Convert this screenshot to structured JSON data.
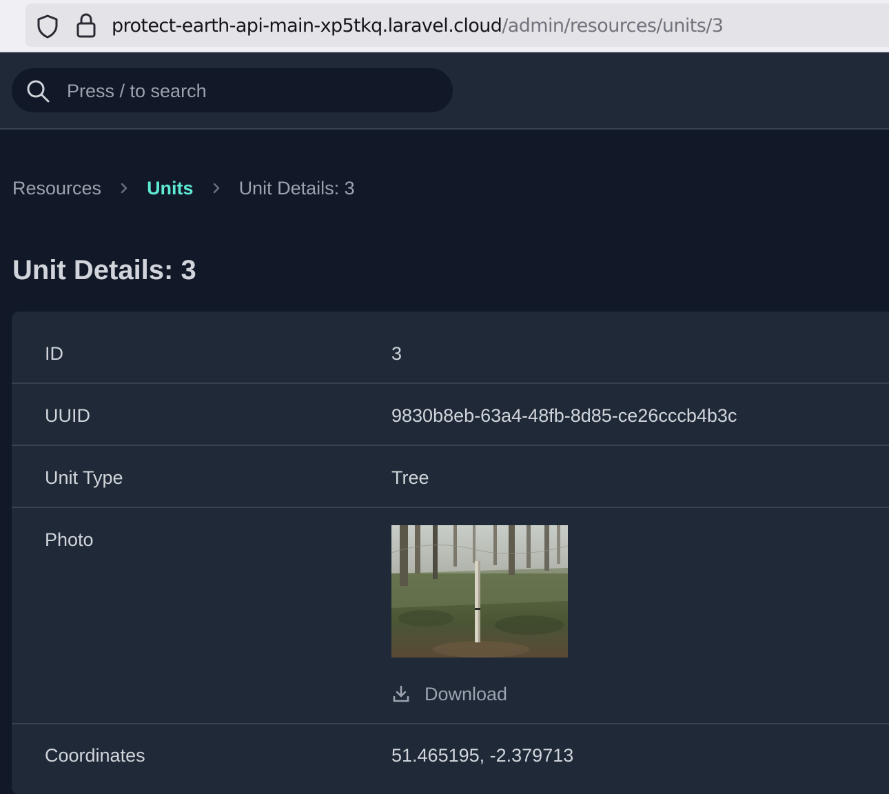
{
  "browser": {
    "url_host": "protect-earth-api-main-xp5tkq.laravel.cloud",
    "url_path": "/admin/resources/units/3"
  },
  "header": {
    "search_placeholder": "Press / to search"
  },
  "breadcrumb": {
    "items": [
      "Resources",
      "Units",
      "Unit Details: 3"
    ]
  },
  "page": {
    "title": "Unit Details: 3"
  },
  "details": {
    "id": {
      "label": "ID",
      "value": "3"
    },
    "uuid": {
      "label": "UUID",
      "value": "9830b8eb-63a4-48fb-8d85-ce26cccb4b3c"
    },
    "unit_type": {
      "label": "Unit Type",
      "value": "Tree"
    },
    "photo": {
      "label": "Photo",
      "download_label": "Download"
    },
    "coordinates": {
      "label": "Coordinates",
      "value": "51.465195, -2.379713"
    }
  },
  "colors": {
    "background": "#111827",
    "panel": "#1f2937",
    "accent": "#5eead4",
    "muted_text": "#9ca3af"
  },
  "icons": [
    "shield-icon",
    "lock-icon",
    "search-icon",
    "chevron-right-icon",
    "download-icon"
  ]
}
